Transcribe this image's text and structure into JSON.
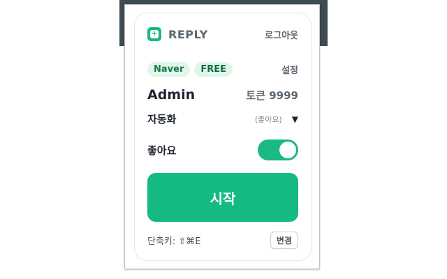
{
  "header": {
    "brand": "REPLY",
    "logout_label": "로그아웃"
  },
  "account": {
    "badges": [
      "Naver",
      "FREE"
    ],
    "settings_label": "설정",
    "username": "Admin",
    "tokens": "토큰 9999"
  },
  "automation": {
    "label": "자동화",
    "selected": "(좋아요)",
    "caret": "▼"
  },
  "like": {
    "label": "좋아요",
    "enabled": true
  },
  "start_label": "시작",
  "shortcut": {
    "text": "단축키: ⇧⌘E",
    "change_label": "변경"
  },
  "colors": {
    "accent": "#14ba80",
    "badge_bg": "#dff6e9",
    "header_strip": "#3f4b53"
  },
  "icons": {
    "logo": "reply-logo-icon",
    "select": "caret-down-icon"
  }
}
